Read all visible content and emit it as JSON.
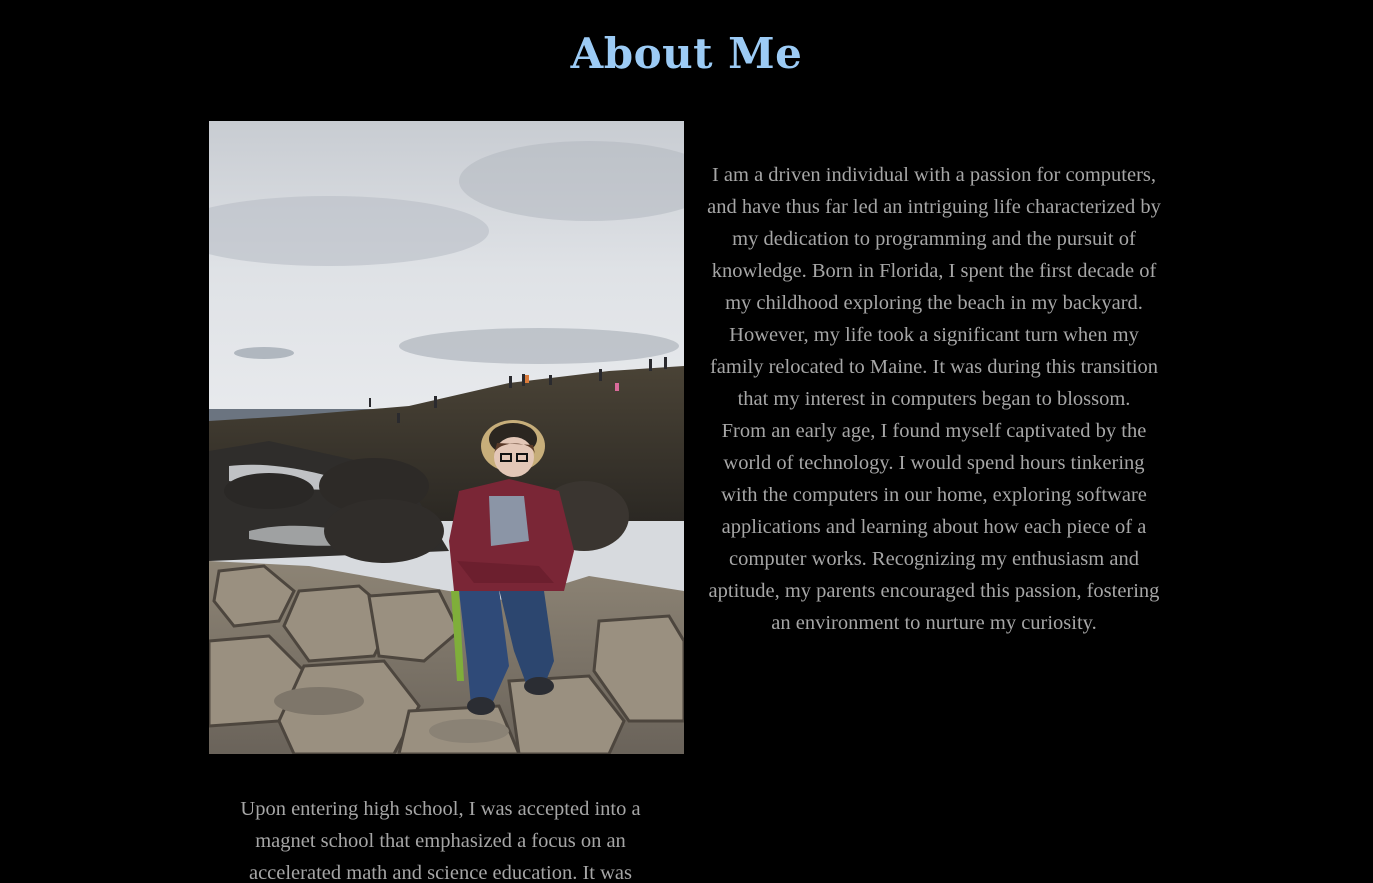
{
  "page": {
    "title": "About Me"
  },
  "photo": {
    "icon": "portrait-photo"
  },
  "bio": {
    "paragraph_1": "I am a driven individual with a passion for computers, and have thus far led an intriguing life characterized by my dedication to programming and the pursuit of knowledge. Born in Florida, I spent the first decade of my childhood exploring the beach in my backyard. However, my life took a significant turn when my family relocated to Maine. It was during this transition that my interest in computers began to blossom.",
    "paragraph_2": "From an early age, I found myself captivated by the world of technology. I would spend hours tinkering with the computers in our home, exploring software applications and learning about how each piece of a computer works. Recognizing my enthusiasm and aptitude, my parents encouraged this passion, fostering an environment to nurture my curiosity.",
    "paragraph_3": "Upon entering high school, I was accepted into a magnet school that emphasized a focus on an accelerated math and science education. It was"
  },
  "colors": {
    "background": "#000000",
    "title": "#9ccbf5",
    "body_text": "#a6a6a6"
  }
}
